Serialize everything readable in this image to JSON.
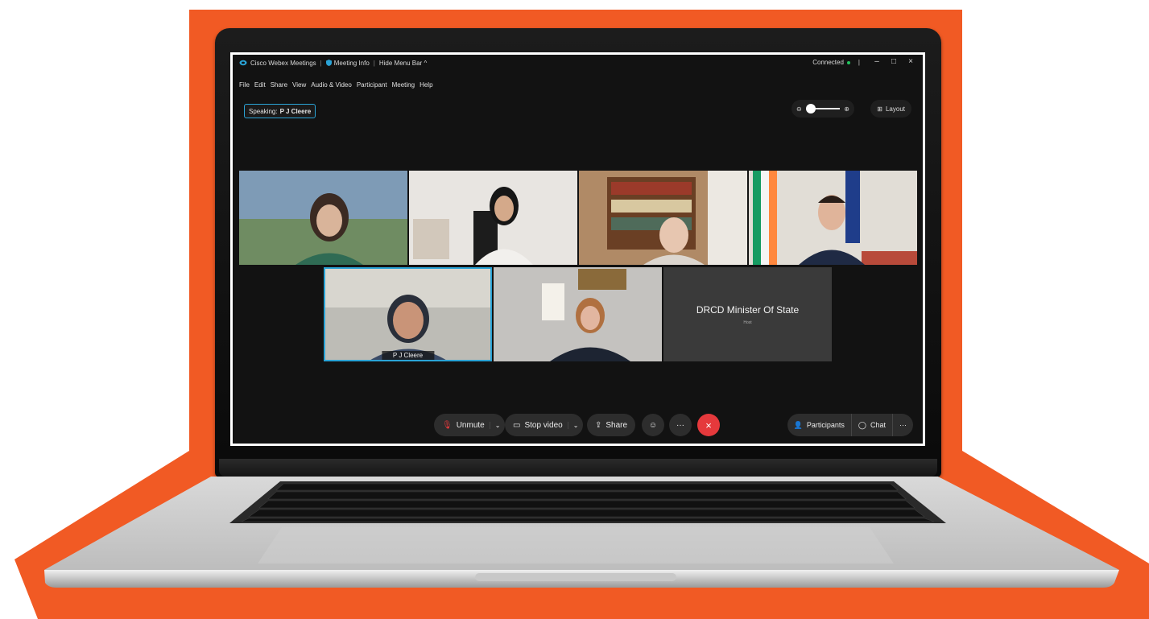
{
  "colors": {
    "backdrop": "#f15a24",
    "accent": "#2aa3d6",
    "leave": "#e5393c",
    "connected": "#22c55e"
  },
  "titlebar": {
    "app_name": "Cisco Webex Meetings",
    "meeting_info": "Meeting Info",
    "hide_menu": "Hide Menu Bar ^",
    "connection_status": "Connected"
  },
  "menu": [
    "File",
    "Edit",
    "Share",
    "View",
    "Audio & Video",
    "Participant",
    "Meeting",
    "Help"
  ],
  "speaking": {
    "label": "Speaking:",
    "name": "P J Cleere"
  },
  "layout_label": "Layout",
  "participants": [
    {
      "name": "",
      "bg": "#6d8aa6",
      "person": "#3a2a22"
    },
    {
      "name": "",
      "bg": "#e3e0dc",
      "person": "#1a1a1a"
    },
    {
      "name": "",
      "bg": "#a47a57",
      "person": "#dcd2c6"
    },
    {
      "name": "",
      "bg": "#d6d0c6",
      "person": "#1e2637"
    },
    {
      "name": "P J Cleere",
      "bg": "#b7b6b0",
      "person": "#2c3a52"
    },
    {
      "name": "",
      "bg": "#bdbbb8",
      "person": "#1d2432"
    }
  ],
  "host_tile": {
    "name": "DRCD Minister Of State",
    "role": "Host"
  },
  "controls": {
    "unmute": "Unmute",
    "stop_video": "Stop video",
    "share": "Share",
    "participants": "Participants",
    "chat": "Chat"
  }
}
